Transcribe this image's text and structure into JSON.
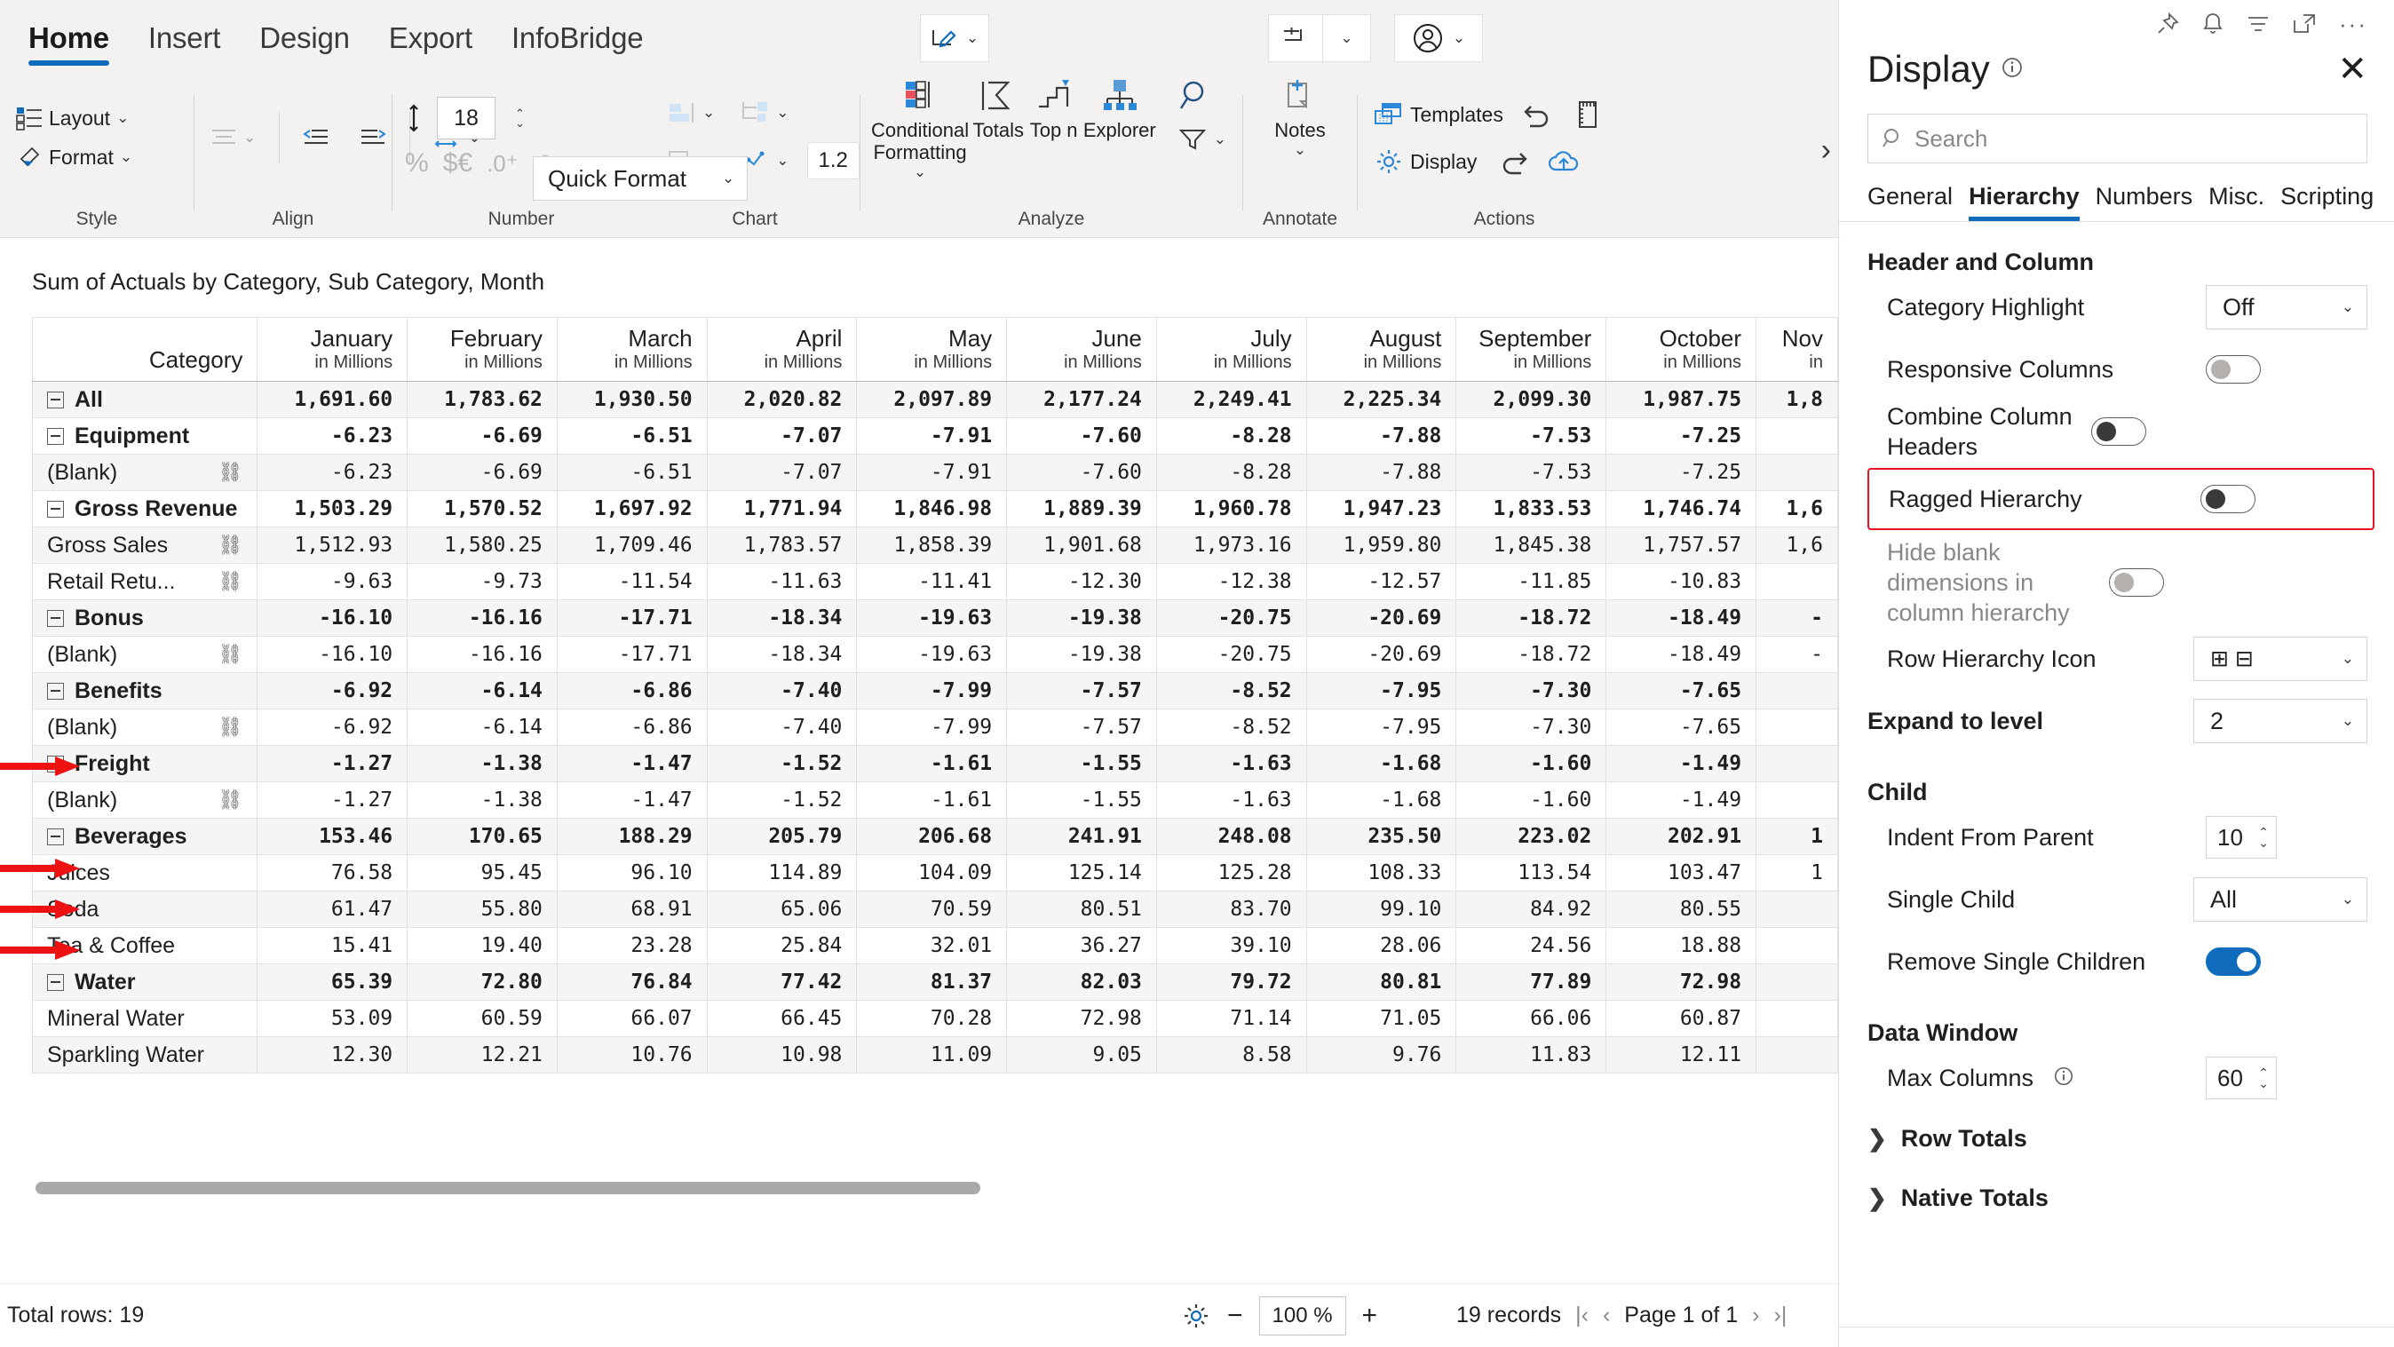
{
  "ribbon": {
    "tabs": [
      {
        "label": "Home",
        "active": true
      },
      {
        "label": "Insert",
        "active": false
      },
      {
        "label": "Design",
        "active": false
      },
      {
        "label": "Export",
        "active": false
      },
      {
        "label": "InfoBridge",
        "active": false
      }
    ],
    "groups": {
      "style": {
        "name": "Style",
        "layout": "Layout",
        "format": "Format"
      },
      "align": {
        "name": "Align"
      },
      "number": {
        "name": "Number",
        "font_size": "18",
        "quick_format": "Quick Format",
        "decimal_scale": "1.2"
      },
      "chart": {
        "name": "Chart"
      },
      "analyze": {
        "name": "Analyze",
        "conditional_formatting": "Conditional\nFormatting",
        "conditional_formatting_l1": "Conditional",
        "conditional_formatting_l2": "Formatting",
        "totals": "Totals",
        "topn": "Top n",
        "explorer": "Explorer"
      },
      "annotate": {
        "name": "Annotate",
        "notes": "Notes"
      },
      "actions": {
        "name": "Actions",
        "templates": "Templates",
        "display": "Display"
      }
    }
  },
  "sheet": {
    "title": "Sum of Actuals by Category, Sub Category, Month",
    "unit_label": "in Millions",
    "category_header": "Category",
    "months": [
      "January",
      "February",
      "March",
      "April",
      "May",
      "June",
      "July",
      "August",
      "September",
      "October",
      "Nov"
    ],
    "rows": [
      {
        "label": "All",
        "level": 0,
        "expandable": true,
        "bold": true,
        "link": false,
        "values": [
          "1,691.60",
          "1,783.62",
          "1,930.50",
          "2,020.82",
          "2,097.89",
          "2,177.24",
          "2,249.41",
          "2,225.34",
          "2,099.30",
          "1,987.75",
          "1,8"
        ]
      },
      {
        "label": "Equipment",
        "level": 0,
        "expandable": true,
        "bold": true,
        "link": false,
        "values": [
          "-6.23",
          "-6.69",
          "-6.51",
          "-7.07",
          "-7.91",
          "-7.60",
          "-8.28",
          "-7.88",
          "-7.53",
          "-7.25",
          ""
        ]
      },
      {
        "label": "(Blank)",
        "level": 1,
        "expandable": false,
        "bold": false,
        "link": true,
        "arrow": true,
        "values": [
          "-6.23",
          "-6.69",
          "-6.51",
          "-7.07",
          "-7.91",
          "-7.60",
          "-8.28",
          "-7.88",
          "-7.53",
          "-7.25",
          ""
        ]
      },
      {
        "label": "Gross Revenue",
        "level": 0,
        "expandable": true,
        "bold": true,
        "link": false,
        "values": [
          "1,503.29",
          "1,570.52",
          "1,697.92",
          "1,771.94",
          "1,846.98",
          "1,889.39",
          "1,960.78",
          "1,947.23",
          "1,833.53",
          "1,746.74",
          "1,6"
        ]
      },
      {
        "label": "Gross Sales",
        "level": 1,
        "expandable": false,
        "bold": false,
        "link": true,
        "values": [
          "1,512.93",
          "1,580.25",
          "1,709.46",
          "1,783.57",
          "1,858.39",
          "1,901.68",
          "1,973.16",
          "1,959.80",
          "1,845.38",
          "1,757.57",
          "1,6"
        ]
      },
      {
        "label": "Retail Retu...",
        "level": 1,
        "expandable": false,
        "bold": false,
        "link": true,
        "values": [
          "-9.63",
          "-9.73",
          "-11.54",
          "-11.63",
          "-11.41",
          "-12.30",
          "-12.38",
          "-12.57",
          "-11.85",
          "-10.83",
          ""
        ]
      },
      {
        "label": "Bonus",
        "level": 0,
        "expandable": true,
        "bold": true,
        "link": false,
        "values": [
          "-16.10",
          "-16.16",
          "-17.71",
          "-18.34",
          "-19.63",
          "-19.38",
          "-20.75",
          "-20.69",
          "-18.72",
          "-18.49",
          "-"
        ]
      },
      {
        "label": "(Blank)",
        "level": 1,
        "expandable": false,
        "bold": false,
        "link": true,
        "arrow": true,
        "values": [
          "-16.10",
          "-16.16",
          "-17.71",
          "-18.34",
          "-19.63",
          "-19.38",
          "-20.75",
          "-20.69",
          "-18.72",
          "-18.49",
          "-"
        ]
      },
      {
        "label": "Benefits",
        "level": 0,
        "expandable": true,
        "bold": true,
        "link": false,
        "values": [
          "-6.92",
          "-6.14",
          "-6.86",
          "-7.40",
          "-7.99",
          "-7.57",
          "-8.52",
          "-7.95",
          "-7.30",
          "-7.65",
          ""
        ]
      },
      {
        "label": "(Blank)",
        "level": 1,
        "expandable": false,
        "bold": false,
        "link": true,
        "arrow": true,
        "values": [
          "-6.92",
          "-6.14",
          "-6.86",
          "-7.40",
          "-7.99",
          "-7.57",
          "-8.52",
          "-7.95",
          "-7.30",
          "-7.65",
          ""
        ]
      },
      {
        "label": "Freight",
        "level": 0,
        "expandable": true,
        "bold": true,
        "link": false,
        "values": [
          "-1.27",
          "-1.38",
          "-1.47",
          "-1.52",
          "-1.61",
          "-1.55",
          "-1.63",
          "-1.68",
          "-1.60",
          "-1.49",
          ""
        ]
      },
      {
        "label": "(Blank)",
        "level": 1,
        "expandable": false,
        "bold": false,
        "link": true,
        "arrow": true,
        "values": [
          "-1.27",
          "-1.38",
          "-1.47",
          "-1.52",
          "-1.61",
          "-1.55",
          "-1.63",
          "-1.68",
          "-1.60",
          "-1.49",
          ""
        ]
      },
      {
        "label": "Beverages",
        "level": 0,
        "expandable": true,
        "bold": true,
        "link": false,
        "values": [
          "153.46",
          "170.65",
          "188.29",
          "205.79",
          "206.68",
          "241.91",
          "248.08",
          "235.50",
          "223.02",
          "202.91",
          "1"
        ]
      },
      {
        "label": "Juices",
        "level": 1,
        "expandable": false,
        "bold": false,
        "link": false,
        "values": [
          "76.58",
          "95.45",
          "96.10",
          "114.89",
          "104.09",
          "125.14",
          "125.28",
          "108.33",
          "113.54",
          "103.47",
          "1"
        ]
      },
      {
        "label": "Soda",
        "level": 1,
        "expandable": false,
        "bold": false,
        "link": false,
        "values": [
          "61.47",
          "55.80",
          "68.91",
          "65.06",
          "70.59",
          "80.51",
          "83.70",
          "99.10",
          "84.92",
          "80.55",
          ""
        ]
      },
      {
        "label": "Tea & Coffee",
        "level": 1,
        "expandable": false,
        "bold": false,
        "link": false,
        "values": [
          "15.41",
          "19.40",
          "23.28",
          "25.84",
          "32.01",
          "36.27",
          "39.10",
          "28.06",
          "24.56",
          "18.88",
          ""
        ]
      },
      {
        "label": "Water",
        "level": 0,
        "expandable": true,
        "bold": true,
        "link": false,
        "values": [
          "65.39",
          "72.80",
          "76.84",
          "77.42",
          "81.37",
          "82.03",
          "79.72",
          "80.81",
          "77.89",
          "72.98",
          ""
        ]
      },
      {
        "label": "Mineral Water",
        "level": 1,
        "expandable": false,
        "bold": false,
        "link": false,
        "values": [
          "53.09",
          "60.59",
          "66.07",
          "66.45",
          "70.28",
          "72.98",
          "71.14",
          "71.05",
          "66.06",
          "60.87",
          ""
        ]
      },
      {
        "label": "Sparkling Water",
        "level": 1,
        "expandable": false,
        "bold": false,
        "link": false,
        "values": [
          "12.30",
          "12.21",
          "10.76",
          "10.98",
          "11.09",
          "9.05",
          "8.58",
          "9.76",
          "11.83",
          "12.11",
          ""
        ]
      }
    ]
  },
  "status": {
    "total_rows": "Total rows: 19",
    "zoom": "100 %",
    "records": "19 records",
    "page": "Page 1 of 1"
  },
  "panel": {
    "title": "Display",
    "search_placeholder": "Search",
    "tabs": [
      {
        "label": "General",
        "active": false
      },
      {
        "label": "Hierarchy",
        "active": true
      },
      {
        "label": "Numbers",
        "active": false
      },
      {
        "label": "Misc.",
        "active": false
      },
      {
        "label": "Scripting",
        "active": false
      }
    ],
    "sections": {
      "header_and_column": {
        "title": "Header and Column",
        "category_highlight": {
          "label": "Category Highlight",
          "value": "Off"
        },
        "responsive_columns": {
          "label": "Responsive Columns",
          "state": "off"
        },
        "combine_column_headers": {
          "label": "Combine Column Headers",
          "state": "on-dark"
        },
        "ragged_hierarchy": {
          "label": "Ragged Hierarchy",
          "state": "on-dark",
          "highlighted": true
        },
        "hide_blank_dimensions": {
          "label": "Hide blank dimensions in column hierarchy",
          "state": "off"
        },
        "row_hierarchy_icon": {
          "label": "Row Hierarchy Icon",
          "value": "⊞ ⊟"
        },
        "expand_to_level": {
          "label": "Expand to level",
          "value": "2"
        }
      },
      "child": {
        "title": "Child",
        "indent_from_parent": {
          "label": "Indent From Parent",
          "value": "10"
        },
        "single_child": {
          "label": "Single Child",
          "value": "All"
        },
        "remove_single_children": {
          "label": "Remove Single Children",
          "state": "on-blue"
        }
      },
      "data_window": {
        "title": "Data Window",
        "max_columns": {
          "label": "Max Columns",
          "value": "60"
        }
      },
      "row_totals": {
        "title": "Row Totals"
      },
      "native_totals": {
        "title": "Native Totals"
      }
    },
    "accent_color": "#0f6cbd",
    "highlight_color": "#e81123"
  }
}
